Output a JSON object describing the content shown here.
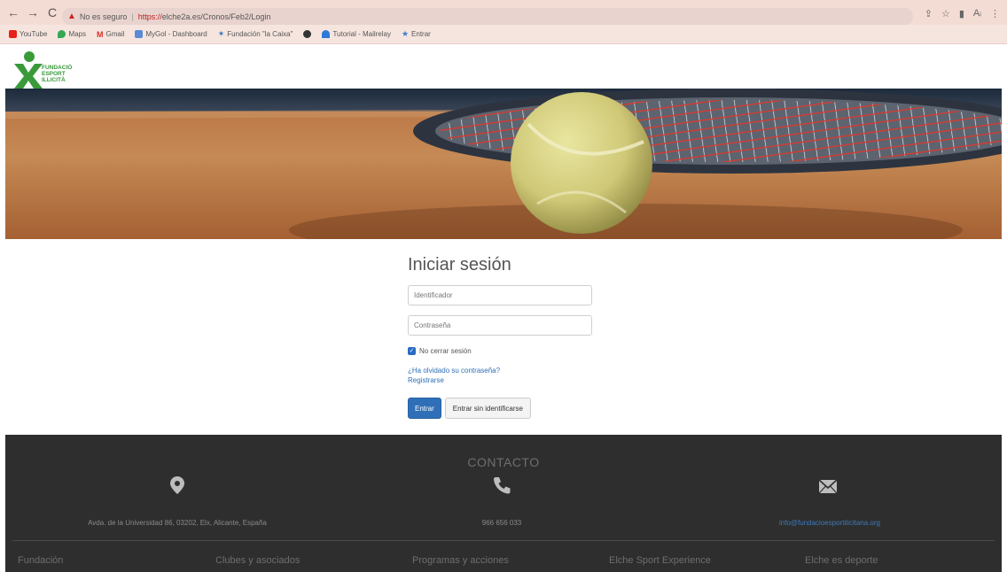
{
  "browser": {
    "security_label": "No es seguro",
    "url_scheme": "https://",
    "url_path": "elche2a.es/Cronos/Feb2/Login",
    "bookmarks": [
      {
        "label": "YouTube",
        "color": "#e62117"
      },
      {
        "label": "Maps",
        "color": "#34a853"
      },
      {
        "label": "Gmail",
        "color": "#d93025"
      },
      {
        "label": "MyGol - Dashboard",
        "color": "#5b8bd6"
      },
      {
        "label": "Fundación \"la Caixa\"",
        "color": "#1c6fc4"
      },
      {
        "label": "",
        "color": "#333333"
      },
      {
        "label": "Tutorial - Mailrelay",
        "color": "#2b7bd8"
      },
      {
        "label": "Entrar",
        "color": "#3a7bd5"
      }
    ]
  },
  "logo": {
    "line1": "FUNDACIÓ",
    "line2": "ESPORT",
    "line3": "ILLICITÀ",
    "color": "#3a9a3a"
  },
  "login": {
    "title": "Iniciar sesión",
    "user_placeholder": "Identificador",
    "password_placeholder": "Contraseña",
    "keep_session_label": "No cerrar sesión",
    "keep_session_checked": true,
    "forgot_link": "¿Ha olvidado su contraseña?",
    "register_link": "Registrarse",
    "submit_label": "Entrar",
    "guest_label": "Entrar sin identificarse"
  },
  "footer": {
    "title": "CONTACTO",
    "address": "Avda. de la Universidad 86, 03202, Elx, Alicante, España",
    "phone": "966 656 033",
    "email": "info@fundacioesportilicitana.org",
    "nav": [
      "Fundación",
      "Clubes y asociados",
      "Programas y acciones",
      "Elche Sport Experience",
      "Elche es deporte"
    ]
  },
  "colors": {
    "primary": "#2f6fb7",
    "footer_bg": "#2e2e2e",
    "chrome_bg": "#f3dcd4"
  }
}
